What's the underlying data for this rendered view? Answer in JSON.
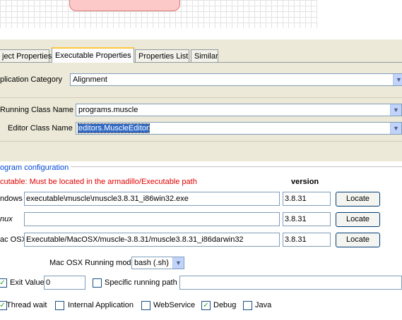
{
  "tabs": [
    {
      "label": "ject Properties"
    },
    {
      "label": "Executable Properties"
    },
    {
      "label": "Properties List"
    },
    {
      "label": "Similar"
    }
  ],
  "properties": {
    "application_category_label": "plication Category",
    "application_category_value": "Alignment",
    "running_class_label": "Running Class Name",
    "running_class_value": "programs.muscle",
    "editor_class_label": "Editor Class Name",
    "editor_class_value": "editors.MuscleEditor"
  },
  "config": {
    "title": "ogram configuration",
    "warning": "cutable: Must be located in the armadillo/Executable path",
    "version_header": "version",
    "rows": [
      {
        "os": "ndows",
        "path": "executable\\muscle\\muscle3.8.31_i86win32.exe",
        "version": "3.8.31",
        "button": "Locate"
      },
      {
        "os": "nux",
        "path": "",
        "version": "3.8.31",
        "button": "Locate"
      },
      {
        "os": "ac OSX",
        "path": "Executable/MacOSX/muscle-3.8.31/muscle3.8.31_i86darwin32",
        "version": "3.8.31",
        "button": "Locate"
      }
    ],
    "mac_mode_label": "Mac OSX Running mode",
    "mac_mode_value": "bash (.sh)",
    "exit_value_label": "Exit Value",
    "exit_value": "0",
    "specific_path_label": "Specific running path",
    "specific_path_value": "",
    "checks": [
      {
        "label": "Thread wait",
        "checked": true
      },
      {
        "label": "Internal Application",
        "checked": false
      },
      {
        "label": "WebService",
        "checked": false
      },
      {
        "label": "Debug",
        "checked": true
      },
      {
        "label": "Java",
        "checked": false
      }
    ]
  },
  "colors": {
    "accent_tab": "#ffc83c",
    "warning": "#e00000",
    "group_title": "#0046d5",
    "selection": "#316ac5"
  }
}
